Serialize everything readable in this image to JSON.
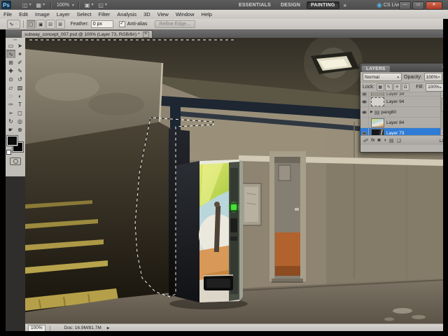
{
  "titlebar": {
    "logo": "Ps",
    "app_icons": [
      {
        "name": "bridge-icon",
        "glyph": "◫"
      },
      {
        "name": "view-extras-icon",
        "glyph": "▦"
      }
    ],
    "zoom_level": "100%",
    "zoom_icons": [
      {
        "name": "arrange-documents-icon",
        "glyph": "▣"
      },
      {
        "name": "screen-mode-icon",
        "glyph": "◱"
      }
    ],
    "workspaces": [
      "ESSENTIALS",
      "DESIGN",
      "PAINTING"
    ],
    "active_workspace": "PAINTING",
    "overflow": "»",
    "cs_live": "CS Live",
    "window_controls": {
      "minimize": "—",
      "restore": "▭",
      "close": "✕"
    }
  },
  "menubar": {
    "items": [
      "File",
      "Edit",
      "Image",
      "Layer",
      "Select",
      "Filter",
      "Analysis",
      "3D",
      "View",
      "Window",
      "Help"
    ]
  },
  "options": {
    "tool_glyph": "∿",
    "selection_modes": [
      {
        "name": "new-selection",
        "glyph": "▢",
        "active": true
      },
      {
        "name": "add-to-selection",
        "glyph": "▣",
        "active": false
      },
      {
        "name": "subtract-from-selection",
        "glyph": "⊟",
        "active": false
      },
      {
        "name": "intersect-with-selection",
        "glyph": "⊞",
        "active": false
      }
    ],
    "feather_label": "Feather:",
    "feather_value": "0 px",
    "anti_alias_label": "Anti-alias",
    "anti_alias_checked": "✓",
    "refine_edge_label": "Refine Edge..."
  },
  "tab": {
    "title": "subway_concept_007.psd @ 100% (Layer 73, RGB/8#) *",
    "close_glyph": "×"
  },
  "toolbox": {
    "tools": [
      {
        "name": "rectangular-marquee-tool",
        "glyph": "▭",
        "selected": false
      },
      {
        "name": "move-tool",
        "glyph": "➤",
        "selected": false
      },
      {
        "name": "lasso-tool",
        "glyph": "∿",
        "selected": true
      },
      {
        "name": "quick-selection-tool",
        "glyph": "✶",
        "selected": false
      },
      {
        "name": "crop-tool",
        "glyph": "⊞",
        "selected": false
      },
      {
        "name": "eyedropper-tool",
        "glyph": "✐",
        "selected": false
      },
      {
        "name": "healing-brush-tool",
        "glyph": "✚",
        "selected": false
      },
      {
        "name": "brush-tool",
        "glyph": "✎",
        "selected": false
      },
      {
        "name": "clone-stamp-tool",
        "glyph": "⊙",
        "selected": false
      },
      {
        "name": "history-brush-tool",
        "glyph": "↺",
        "selected": false
      },
      {
        "name": "eraser-tool",
        "glyph": "▱",
        "selected": false
      },
      {
        "name": "gradient-tool",
        "glyph": "▨",
        "selected": false
      },
      {
        "name": "blur-tool",
        "glyph": "◌",
        "selected": false
      },
      {
        "name": "dodge-tool",
        "glyph": "◐",
        "selected": false
      },
      {
        "name": "pen-tool",
        "glyph": "✑",
        "selected": false
      },
      {
        "name": "type-tool",
        "glyph": "T",
        "selected": false
      },
      {
        "name": "path-selection-tool",
        "glyph": "➢",
        "selected": false
      },
      {
        "name": "shape-tool",
        "glyph": "◻",
        "selected": false
      },
      {
        "name": "3d-rotate-tool",
        "glyph": "↻",
        "selected": false
      },
      {
        "name": "3d-camera-tool",
        "glyph": "◎",
        "selected": false
      },
      {
        "name": "hand-tool",
        "glyph": "☛",
        "selected": false
      },
      {
        "name": "zoom-tool",
        "glyph": "⊕",
        "selected": false
      }
    ]
  },
  "layers": {
    "tab": "LAYERS",
    "collapse_glyph": "▪",
    "blend_mode": "Normal",
    "blend_caret": "▼",
    "opacity_label": "Opacity:",
    "opacity_value": "100%",
    "lock_label": "Lock:",
    "lock_icons": [
      {
        "name": "lock-transparency-icon",
        "glyph": "▦"
      },
      {
        "name": "lock-pixels-icon",
        "glyph": "✎"
      },
      {
        "name": "lock-position-icon",
        "glyph": "✛"
      },
      {
        "name": "lock-all-icon",
        "glyph": "Ω"
      }
    ],
    "fill_label": "Fill:",
    "fill_value": "100%",
    "rows": [
      {
        "name": "Layer 34",
        "visible": true,
        "kind": "pixel",
        "thumb": "plain",
        "selected": false,
        "clipped": true
      },
      {
        "name": "Layer 94",
        "visible": true,
        "kind": "pixel",
        "thumb": "dashed",
        "selected": false,
        "clipped": false
      },
      {
        "name": "pang80",
        "visible": true,
        "kind": "group",
        "thumb": "group",
        "selected": false,
        "clipped": false
      },
      {
        "name": "Layer 84",
        "visible": false,
        "kind": "pixel",
        "thumb": "art",
        "selected": false,
        "clipped": false
      },
      {
        "name": "Layer 73",
        "visible": true,
        "kind": "pixel",
        "thumb": "dark",
        "selected": true,
        "clipped": false
      }
    ],
    "bottom_icons": [
      {
        "name": "link-layers-icon",
        "glyph": "☍"
      },
      {
        "name": "layer-styles-icon",
        "glyph": "fx"
      },
      {
        "name": "add-layer-mask-icon",
        "glyph": "◙"
      },
      {
        "name": "new-adjustment-layer-icon",
        "glyph": "◑"
      },
      {
        "name": "new-group-icon",
        "glyph": "▤"
      },
      {
        "name": "new-layer-icon",
        "glyph": "❏"
      },
      {
        "name": "delete-layer-icon",
        "glyph": "⊔"
      }
    ]
  },
  "status": {
    "zoom": "100%",
    "doc": "Doc: 16.9M/81.7M",
    "arrow": "▶"
  },
  "canvas_colors": {
    "machine_light_green": "#46e13a",
    "kick_panel_orange": "#b2622c",
    "steel_beam_navy": "#1d2631",
    "stairs_safety_yellow": "#b7a34c"
  }
}
